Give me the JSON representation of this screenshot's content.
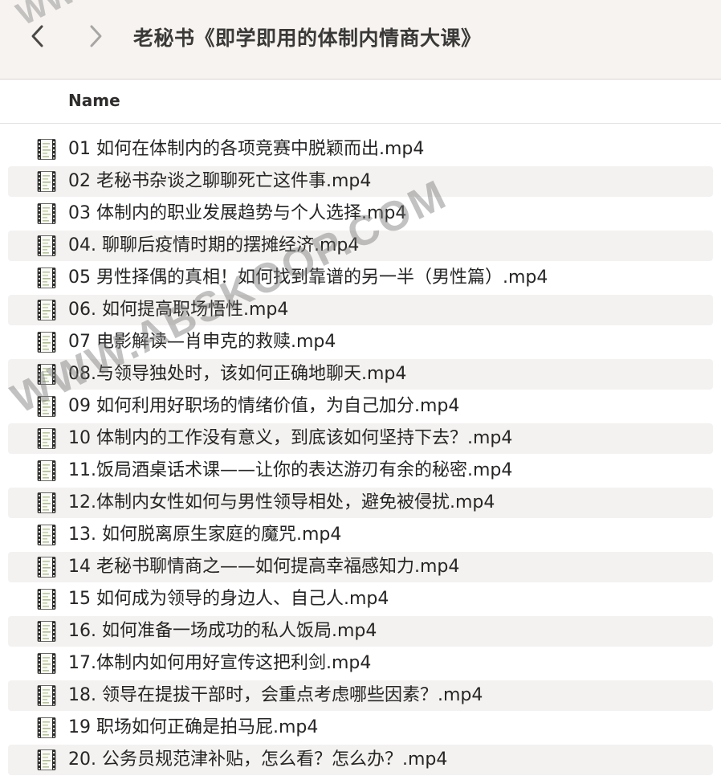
{
  "toolbar": {
    "title": "老秘书《即学即用的体制内情商大课》",
    "back_icon": "chevron-left-icon",
    "forward_icon": "chevron-right-icon"
  },
  "columns": {
    "name": "Name"
  },
  "files": [
    "01 如何在体制内的各项竞赛中脱颖而出.mp4",
    "02 老秘书杂谈之聊聊死亡这件事.mp4",
    "03 体制内的职业发展趋势与个人选择.mp4",
    "04. 聊聊后疫情时期的摆摊经济.mp4",
    "05 男性择偶的真相！如何找到靠谱的另一半（男性篇）.mp4",
    "06. 如何提高职场悟性.mp4",
    "07 电影解读—肖申克的救赎.mp4",
    "08.与领导独处时，该如何正确地聊天.mp4",
    "09 如何利用好职场的情绪价值，为自己加分.mp4",
    "10 体制内的工作没有意义，到底该如何坚持下去？.mp4",
    "11.饭局酒桌话术课——让你的表达游刃有余的秘密.mp4",
    "12.体制内女性如何与男性领导相处，避免被侵扰.mp4",
    "13. 如何脱离原生家庭的魔咒.mp4",
    "14 老秘书聊情商之——如何提高幸福感知力.mp4",
    "15 如何成为领导的身边人、自己人.mp4",
    "16. 如何准备一场成功的私人饭局.mp4",
    "17.体制内如何用好宣传这把利剑.mp4",
    "18. 领导在提拔干部时，会重点考虑哪些因素？.mp4",
    "19 职场如何正确是拍马屁.mp4",
    "20. 公务员规范津补贴，怎么看？怎么办？.mp4"
  ],
  "file_icon": "video-file-icon",
  "watermark": "WWW.ABSKOOP.COM",
  "watermark_top": "WW"
}
